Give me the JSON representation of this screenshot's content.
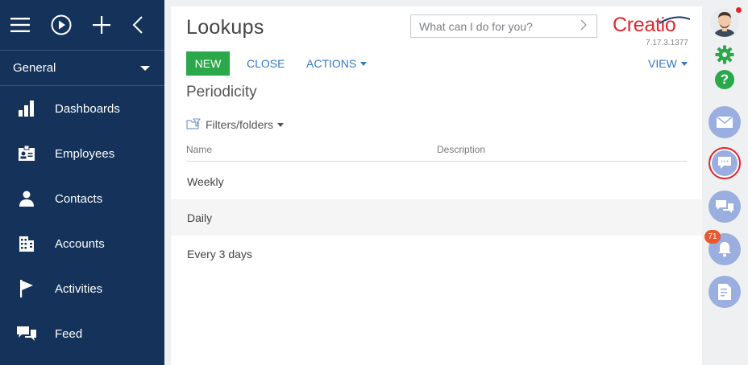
{
  "sidebar": {
    "workspace": "General",
    "items": [
      {
        "label": "Dashboards",
        "icon": "bar-chart-icon"
      },
      {
        "label": "Employees",
        "icon": "id-badge-icon"
      },
      {
        "label": "Contacts",
        "icon": "person-icon"
      },
      {
        "label": "Accounts",
        "icon": "building-icon"
      },
      {
        "label": "Activities",
        "icon": "flag-icon"
      },
      {
        "label": "Feed",
        "icon": "chat-bubbles-icon"
      }
    ]
  },
  "header": {
    "title": "Lookups",
    "search_placeholder": "What can I do for you?",
    "logo_text": "Creatio",
    "version": "7.17.3.1377"
  },
  "toolbar": {
    "new_label": "NEW",
    "close_label": "CLOSE",
    "actions_label": "ACTIONS",
    "view_label": "VIEW"
  },
  "section": {
    "subtitle": "Periodicity",
    "filters_label": "Filters/folders"
  },
  "grid": {
    "columns": [
      "Name",
      "Description"
    ],
    "rows": [
      {
        "name": "Weekly",
        "description": ""
      },
      {
        "name": "Daily",
        "description": ""
      },
      {
        "name": "Every 3 days",
        "description": ""
      }
    ]
  },
  "rail": {
    "notification_count": "71",
    "colors": {
      "accent_green": "#2aa84a",
      "accent_red": "#e3262b",
      "rail_button": "#9aaee0"
    }
  }
}
